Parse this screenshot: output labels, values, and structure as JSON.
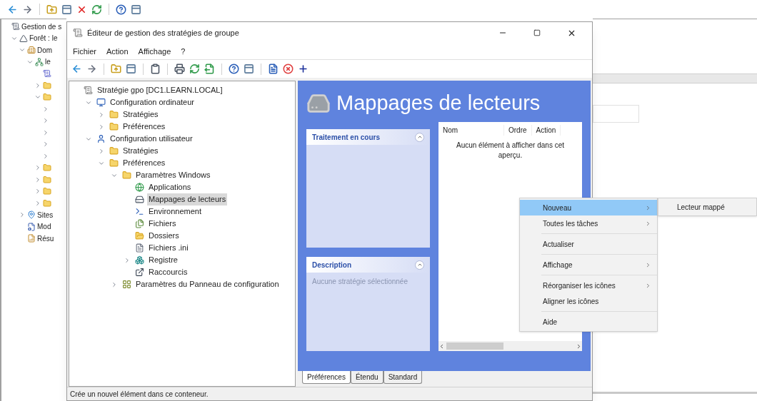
{
  "background": {
    "tree": [
      {
        "label": "Gestion de s",
        "kind": "gpm",
        "children": [
          {
            "label": "Forêt : le",
            "kind": "forest",
            "expanded": true,
            "children": [
              {
                "label": "Dom",
                "kind": "domain",
                "expanded": true,
                "children": [
                  {
                    "label": "le",
                    "kind": "domain2",
                    "expanded": true,
                    "children": [
                      {
                        "kind": "policy"
                      },
                      {
                        "kind": "folder",
                        "expanded": false
                      },
                      {
                        "kind": "folder",
                        "expanded": true,
                        "children": [
                          {
                            "expanded": false
                          },
                          {
                            "expanded": false
                          },
                          {
                            "expanded": false
                          },
                          {
                            "expanded": false
                          },
                          {
                            "expanded": false
                          }
                        ]
                      },
                      {
                        "kind": "folder",
                        "expanded": false
                      },
                      {
                        "kind": "folder",
                        "expanded": false
                      },
                      {
                        "kind": "folder",
                        "expanded": false
                      },
                      {
                        "kind": "folder",
                        "expanded": false
                      }
                    ]
                  }
                ]
              },
              {
                "label": "Sites",
                "kind": "sites",
                "expanded": false
              },
              {
                "label": "Mod",
                "kind": "model"
              },
              {
                "label": "Résu",
                "kind": "results"
              }
            ]
          }
        ]
      }
    ]
  },
  "window": {
    "title": "Éditeur de gestion des stratégies de groupe",
    "menu": [
      "Fichier",
      "Action",
      "Affichage",
      "?"
    ],
    "tree": [
      {
        "label": "Stratégie gpo [DC1.LEARN.LOCAL]",
        "kind": "gpo",
        "selected": false,
        "children": [
          {
            "label": "Configuration ordinateur",
            "kind": "computer",
            "expanded": true,
            "selected": false,
            "children": [
              {
                "label": "Stratégies",
                "kind": "folder",
                "expanded": false,
                "selected": false
              },
              {
                "label": "Préférences",
                "kind": "folder",
                "expanded": false,
                "selected": false
              }
            ]
          },
          {
            "label": "Configuration utilisateur",
            "kind": "user",
            "expanded": true,
            "selected": false,
            "children": [
              {
                "label": "Stratégies",
                "kind": "folder",
                "expanded": false,
                "selected": false
              },
              {
                "label": "Préférences",
                "kind": "folder",
                "expanded": true,
                "selected": false,
                "children": [
                  {
                    "label": "Paramètres Windows",
                    "kind": "folder",
                    "expanded": true,
                    "selected": false,
                    "children": [
                      {
                        "label": "Applications",
                        "kind": "apps",
                        "selected": false
                      },
                      {
                        "label": "Mappages de lecteurs",
                        "kind": "drive",
                        "selected": true
                      },
                      {
                        "label": "Environnement",
                        "kind": "env",
                        "selected": false
                      },
                      {
                        "label": "Fichiers",
                        "kind": "files",
                        "selected": false
                      },
                      {
                        "label": "Dossiers",
                        "kind": "folders",
                        "selected": false
                      },
                      {
                        "label": "Fichiers .ini",
                        "kind": "ini",
                        "selected": false
                      },
                      {
                        "label": "Registre",
                        "kind": "registry",
                        "expanded": false,
                        "selected": false
                      },
                      {
                        "label": "Raccourcis",
                        "kind": "shortcut",
                        "selected": false
                      }
                    ]
                  },
                  {
                    "label": "Paramètres du Panneau de configuration",
                    "kind": "control",
                    "expanded": false,
                    "selected": false
                  }
                ]
              }
            ]
          }
        ]
      }
    ],
    "panel": {
      "heading": "Mappages de lecteurs",
      "cards": [
        {
          "title": "Traitement en cours",
          "expanded": true
        },
        {
          "title": "Description",
          "expanded": true,
          "text": "Aucune stratégie sélectionnée"
        }
      ],
      "list": {
        "columns": [
          "Nom",
          "Ordre",
          "Action"
        ],
        "empty_message": "Aucun élément à afficher dans cet aperçu."
      }
    },
    "tabs": [
      {
        "label": "Préférences",
        "selected": true
      },
      {
        "label": "Étendu",
        "selected": false
      },
      {
        "label": "Standard",
        "selected": false
      }
    ],
    "status_bar": "Crée un nouvel élément dans ce conteneur."
  },
  "context_menu": {
    "items": [
      {
        "kind": "item",
        "label": "Nouveau",
        "submenu": true,
        "selected": true
      },
      {
        "kind": "item",
        "label": "Toutes les tâches",
        "submenu": true,
        "selected": false
      },
      {
        "kind": "separator"
      },
      {
        "kind": "item",
        "label": "Actualiser",
        "submenu": false,
        "selected": false
      },
      {
        "kind": "separator"
      },
      {
        "kind": "item",
        "label": "Affichage",
        "submenu": true,
        "selected": false
      },
      {
        "kind": "separator"
      },
      {
        "kind": "item",
        "label": "Réorganiser les icônes",
        "submenu": true,
        "selected": false
      },
      {
        "kind": "item",
        "label": "Aligner les icônes",
        "submenu": false,
        "selected": false
      },
      {
        "kind": "separator"
      },
      {
        "kind": "item",
        "label": "Aide",
        "submenu": false,
        "selected": false
      }
    ]
  },
  "submenu": {
    "items": [
      {
        "label": "Lecteur mappé",
        "selected": false
      }
    ]
  }
}
